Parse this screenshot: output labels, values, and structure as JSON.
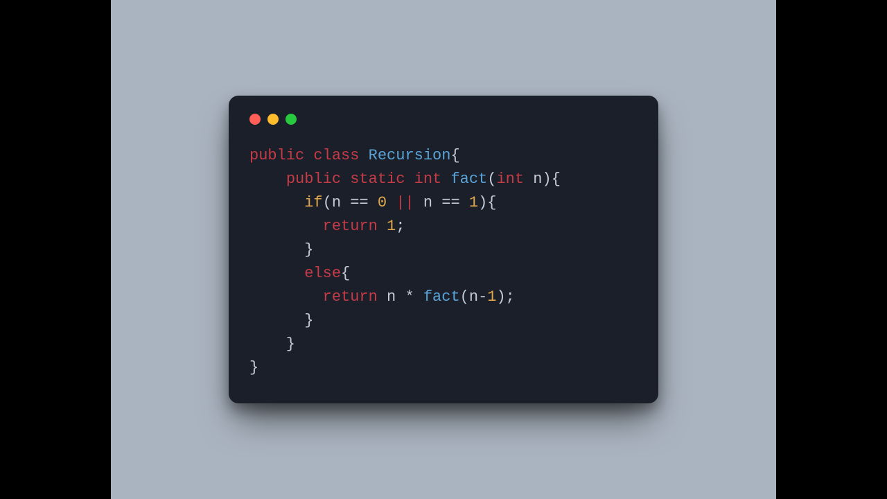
{
  "colors": {
    "window_bg": "#1b1f29",
    "stage_bg": "#aab4c0",
    "traffic_red": "#ff5f56",
    "traffic_yellow": "#ffbd2e",
    "traffic_green": "#27c93f",
    "keyword": "#c53b47",
    "name": "#5aa4d8",
    "cond_num": "#e0a84a",
    "default": "#c3cbd8"
  },
  "code_plain": "public class Recursion{\n    public static int fact(int n){\n      if(n == 0 || n == 1){\n        return 1;\n      }\n      else{\n        return n * fact(n-1);\n      }\n    }\n}",
  "code": {
    "lines": [
      [
        {
          "t": "public",
          "c": "kw"
        },
        {
          "t": " ",
          "c": "op"
        },
        {
          "t": "class",
          "c": "kw"
        },
        {
          "t": " ",
          "c": "op"
        },
        {
          "t": "Recursion",
          "c": "classnm"
        },
        {
          "t": "{",
          "c": "punc"
        }
      ],
      [
        {
          "t": "    ",
          "c": "op"
        },
        {
          "t": "public",
          "c": "kw"
        },
        {
          "t": " ",
          "c": "op"
        },
        {
          "t": "static",
          "c": "kw"
        },
        {
          "t": " ",
          "c": "op"
        },
        {
          "t": "int",
          "c": "type"
        },
        {
          "t": " ",
          "c": "op"
        },
        {
          "t": "fact",
          "c": "fn"
        },
        {
          "t": "(",
          "c": "punc"
        },
        {
          "t": "int",
          "c": "type"
        },
        {
          "t": " n",
          "c": "ident"
        },
        {
          "t": "){",
          "c": "punc"
        }
      ],
      [
        {
          "t": "      ",
          "c": "op"
        },
        {
          "t": "if",
          "c": "cond"
        },
        {
          "t": "(",
          "c": "punc"
        },
        {
          "t": "n ",
          "c": "ident"
        },
        {
          "t": "==",
          "c": "op"
        },
        {
          "t": " ",
          "c": "op"
        },
        {
          "t": "0",
          "c": "num"
        },
        {
          "t": " ",
          "c": "op"
        },
        {
          "t": "||",
          "c": "kw"
        },
        {
          "t": " n ",
          "c": "ident"
        },
        {
          "t": "==",
          "c": "op"
        },
        {
          "t": " ",
          "c": "op"
        },
        {
          "t": "1",
          "c": "num"
        },
        {
          "t": "){",
          "c": "punc"
        }
      ],
      [
        {
          "t": "        ",
          "c": "op"
        },
        {
          "t": "return",
          "c": "kw"
        },
        {
          "t": " ",
          "c": "op"
        },
        {
          "t": "1",
          "c": "num"
        },
        {
          "t": ";",
          "c": "punc"
        }
      ],
      [
        {
          "t": "      }",
          "c": "punc"
        }
      ],
      [
        {
          "t": "      ",
          "c": "op"
        },
        {
          "t": "else",
          "c": "kw"
        },
        {
          "t": "{",
          "c": "punc"
        }
      ],
      [
        {
          "t": "        ",
          "c": "op"
        },
        {
          "t": "return",
          "c": "kw"
        },
        {
          "t": " n ",
          "c": "ident"
        },
        {
          "t": "*",
          "c": "op"
        },
        {
          "t": " ",
          "c": "op"
        },
        {
          "t": "fact",
          "c": "fn"
        },
        {
          "t": "(",
          "c": "punc"
        },
        {
          "t": "n",
          "c": "ident"
        },
        {
          "t": "-",
          "c": "op"
        },
        {
          "t": "1",
          "c": "num"
        },
        {
          "t": ");",
          "c": "punc"
        }
      ],
      [
        {
          "t": "      }",
          "c": "punc"
        }
      ],
      [
        {
          "t": "    }",
          "c": "punc"
        }
      ],
      [
        {
          "t": "}",
          "c": "punc"
        }
      ]
    ]
  }
}
